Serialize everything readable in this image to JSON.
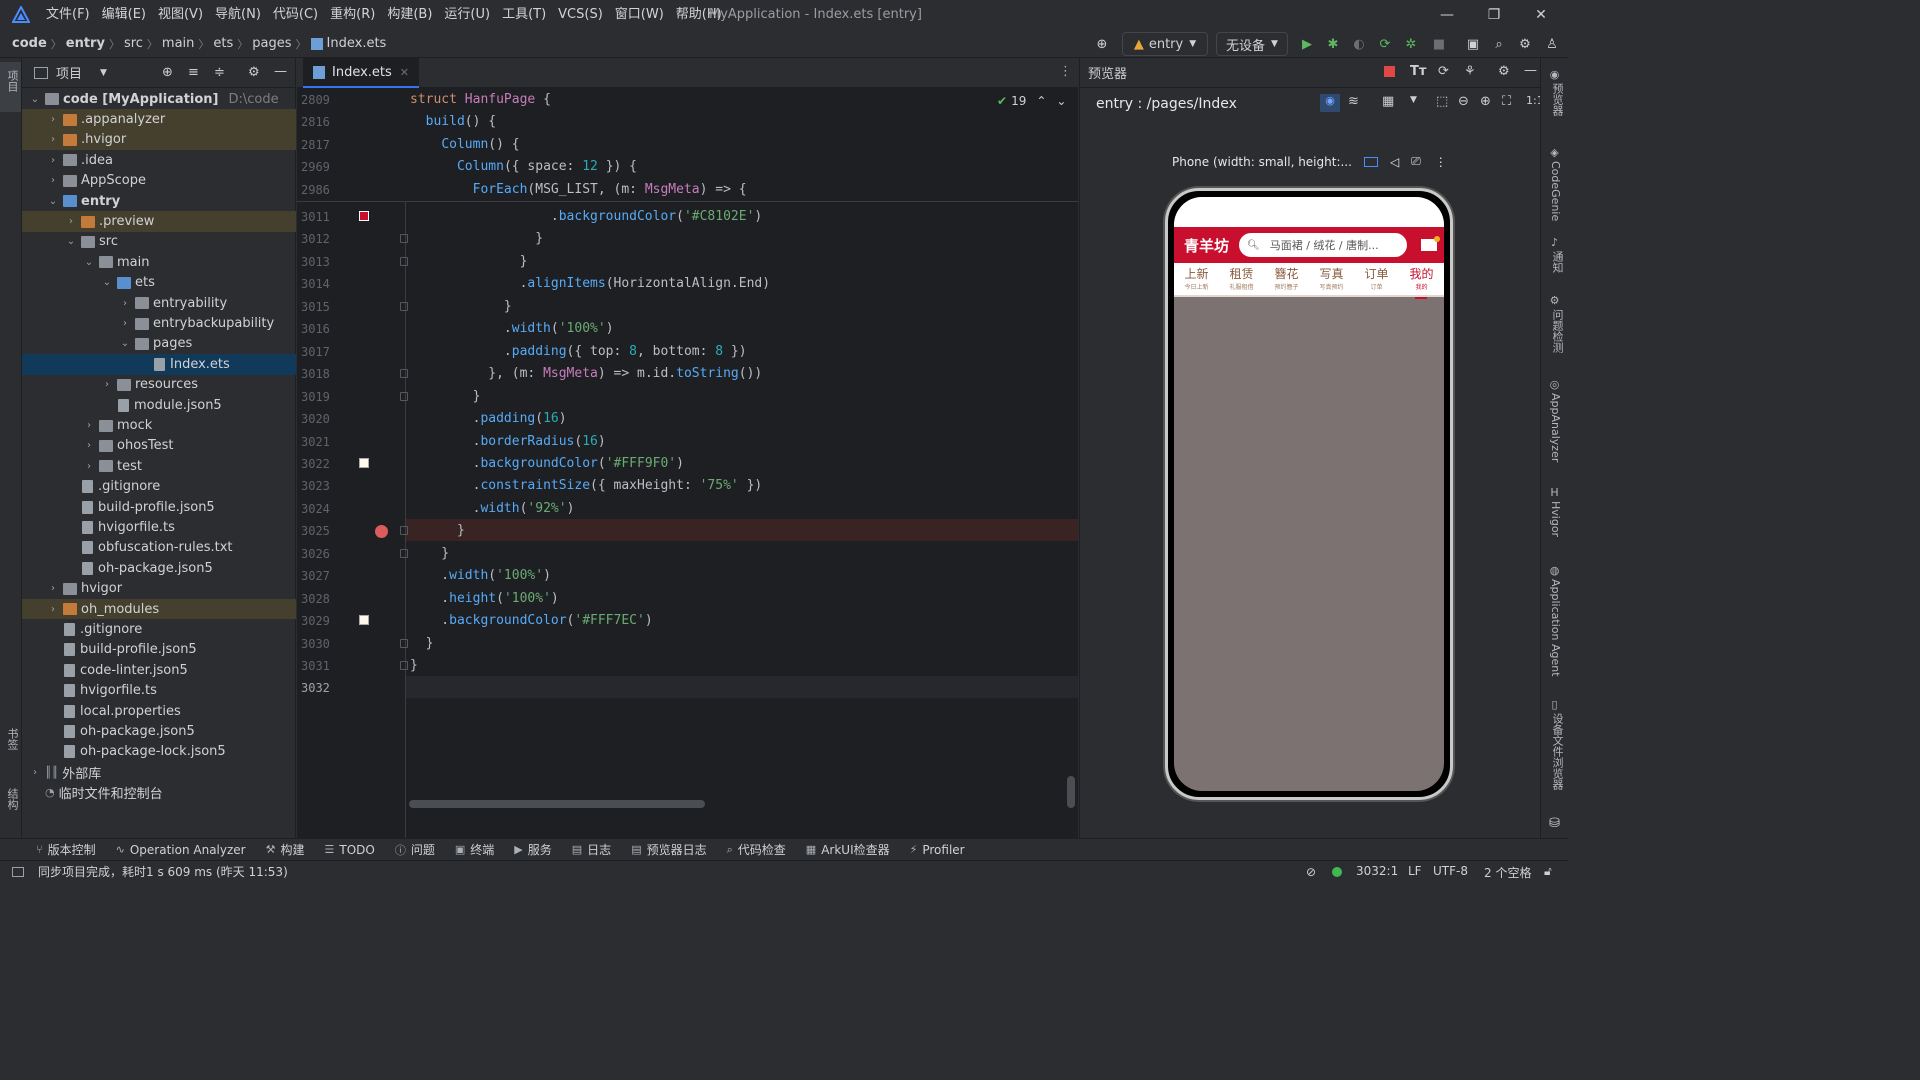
{
  "menu": {
    "items": [
      "文件(F)",
      "编辑(E)",
      "视图(V)",
      "导航(N)",
      "代码(C)",
      "重构(R)",
      "构建(B)",
      "运行(U)",
      "工具(T)",
      "VCS(S)",
      "窗口(W)",
      "帮助(H)"
    ],
    "window_title": "MyApplication - Index.ets [entry]"
  },
  "breadcrumb": {
    "items": [
      "code",
      "entry",
      "src",
      "main",
      "ets",
      "pages",
      "Index.ets"
    ]
  },
  "toolbar": {
    "module": "entry",
    "device": "无设备"
  },
  "project": {
    "title": "项目",
    "tree": [
      {
        "label": "code [MyApplication]",
        "extra": "D:\\code",
        "depth": 0,
        "arrow": "open",
        "icon": "folder",
        "bold": true
      },
      {
        "label": ".appanalyzer",
        "depth": 1,
        "arrow": "closed",
        "icon": "folder-orange",
        "hl": true
      },
      {
        "label": ".hvigor",
        "depth": 1,
        "arrow": "closed",
        "icon": "folder-orange",
        "hl": true
      },
      {
        "label": ".idea",
        "depth": 1,
        "arrow": "closed",
        "icon": "folder"
      },
      {
        "label": "AppScope",
        "depth": 1,
        "arrow": "closed",
        "icon": "folder"
      },
      {
        "label": "entry",
        "depth": 1,
        "arrow": "open",
        "icon": "folder-blue",
        "bold": true
      },
      {
        "label": ".preview",
        "depth": 2,
        "arrow": "closed",
        "icon": "folder-orange",
        "hl": true
      },
      {
        "label": "src",
        "depth": 2,
        "arrow": "open",
        "icon": "folder"
      },
      {
        "label": "main",
        "depth": 3,
        "arrow": "open",
        "icon": "folder"
      },
      {
        "label": "ets",
        "depth": 4,
        "arrow": "open",
        "icon": "folder-blue"
      },
      {
        "label": "entryability",
        "depth": 5,
        "arrow": "closed",
        "icon": "folder"
      },
      {
        "label": "entrybackupability",
        "depth": 5,
        "arrow": "closed",
        "icon": "folder"
      },
      {
        "label": "pages",
        "depth": 5,
        "arrow": "open",
        "icon": "folder"
      },
      {
        "label": "Index.ets",
        "depth": 6,
        "arrow": "none",
        "icon": "file",
        "sel": true
      },
      {
        "label": "resources",
        "depth": 4,
        "arrow": "closed",
        "icon": "folder"
      },
      {
        "label": "module.json5",
        "depth": 4,
        "arrow": "none",
        "icon": "file"
      },
      {
        "label": "mock",
        "depth": 3,
        "arrow": "closed",
        "icon": "folder"
      },
      {
        "label": "ohosTest",
        "depth": 3,
        "arrow": "closed",
        "icon": "folder"
      },
      {
        "label": "test",
        "depth": 3,
        "arrow": "closed",
        "icon": "folder"
      },
      {
        "label": ".gitignore",
        "depth": 2,
        "arrow": "none",
        "icon": "file"
      },
      {
        "label": "build-profile.json5",
        "depth": 2,
        "arrow": "none",
        "icon": "file"
      },
      {
        "label": "hvigorfile.ts",
        "depth": 2,
        "arrow": "none",
        "icon": "file"
      },
      {
        "label": "obfuscation-rules.txt",
        "depth": 2,
        "arrow": "none",
        "icon": "file"
      },
      {
        "label": "oh-package.json5",
        "depth": 2,
        "arrow": "none",
        "icon": "file"
      },
      {
        "label": "hvigor",
        "depth": 1,
        "arrow": "closed",
        "icon": "folder"
      },
      {
        "label": "oh_modules",
        "depth": 1,
        "arrow": "closed",
        "icon": "folder-orange",
        "hl": true
      },
      {
        "label": ".gitignore",
        "depth": 1,
        "arrow": "none",
        "icon": "file"
      },
      {
        "label": "build-profile.json5",
        "depth": 1,
        "arrow": "none",
        "icon": "file"
      },
      {
        "label": "code-linter.json5",
        "depth": 1,
        "arrow": "none",
        "icon": "file"
      },
      {
        "label": "hvigorfile.ts",
        "depth": 1,
        "arrow": "none",
        "icon": "file"
      },
      {
        "label": "local.properties",
        "depth": 1,
        "arrow": "none",
        "icon": "file"
      },
      {
        "label": "oh-package.json5",
        "depth": 1,
        "arrow": "none",
        "icon": "file"
      },
      {
        "label": "oh-package-lock.json5",
        "depth": 1,
        "arrow": "none",
        "icon": "file"
      },
      {
        "label": "外部库",
        "depth": 0,
        "arrow": "closed",
        "icon": "lib"
      },
      {
        "label": "临时文件和控制台",
        "depth": 0,
        "arrow": "none",
        "icon": "scratch"
      }
    ]
  },
  "editor": {
    "tab": "Index.ets",
    "inspections": "19",
    "sticky": [
      {
        "ln": "2809",
        "code": [
          [
            "kw",
            "struct "
          ],
          [
            "ty",
            "HanfuPage"
          ],
          [
            "plain",
            " {"
          ]
        ]
      },
      {
        "ln": "2816",
        "code": [
          [
            "plain",
            "  "
          ],
          [
            "fn",
            "build"
          ],
          [
            "plain",
            "() {"
          ]
        ]
      },
      {
        "ln": "2817",
        "code": [
          [
            "plain",
            "    "
          ],
          [
            "fn",
            "Column"
          ],
          [
            "plain",
            "() {"
          ]
        ]
      },
      {
        "ln": "2969",
        "code": [
          [
            "plain",
            "      "
          ],
          [
            "fn",
            "Column"
          ],
          [
            "plain",
            "({ space: "
          ],
          [
            "num",
            "12"
          ],
          [
            "plain",
            " }) {"
          ]
        ]
      },
      {
        "ln": "2986",
        "code": [
          [
            "plain",
            "        "
          ],
          [
            "fn",
            "ForEach"
          ],
          [
            "plain",
            "(MSG_LIST, (m: "
          ],
          [
            "ty",
            "MsgMeta"
          ],
          [
            "plain",
            ") => {"
          ]
        ]
      }
    ],
    "lines": [
      {
        "ln": "3011",
        "code": [
          [
            "plain",
            "                  ."
          ],
          [
            "fn",
            "backgroundColor"
          ],
          [
            "plain",
            "("
          ],
          [
            "str",
            "'#C8102E'"
          ],
          [
            "plain",
            ")"
          ]
        ]
      },
      {
        "ln": "3012",
        "code": [
          [
            "plain",
            "                }"
          ]
        ]
      },
      {
        "ln": "3013",
        "code": [
          [
            "plain",
            "              }"
          ]
        ]
      },
      {
        "ln": "3014",
        "code": [
          [
            "plain",
            "              ."
          ],
          [
            "fn",
            "alignItems"
          ],
          [
            "plain",
            "(HorizontalAlign.End)"
          ]
        ]
      },
      {
        "ln": "3015",
        "code": [
          [
            "plain",
            "            }"
          ]
        ]
      },
      {
        "ln": "3016",
        "code": [
          [
            "plain",
            "            ."
          ],
          [
            "fn",
            "width"
          ],
          [
            "plain",
            "("
          ],
          [
            "str",
            "'100%'"
          ],
          [
            "plain",
            ")"
          ]
        ]
      },
      {
        "ln": "3017",
        "code": [
          [
            "plain",
            "            ."
          ],
          [
            "fn",
            "padding"
          ],
          [
            "plain",
            "({ top: "
          ],
          [
            "num",
            "8"
          ],
          [
            "plain",
            ", bottom: "
          ],
          [
            "num",
            "8"
          ],
          [
            "plain",
            " })"
          ]
        ]
      },
      {
        "ln": "3018",
        "code": [
          [
            "plain",
            "          }, (m: "
          ],
          [
            "ty",
            "MsgMeta"
          ],
          [
            "plain",
            ") => m.id."
          ],
          [
            "fn",
            "toString"
          ],
          [
            "plain",
            "())"
          ]
        ]
      },
      {
        "ln": "3019",
        "code": [
          [
            "plain",
            "        }"
          ]
        ]
      },
      {
        "ln": "3020",
        "code": [
          [
            "plain",
            "        ."
          ],
          [
            "fn",
            "padding"
          ],
          [
            "plain",
            "("
          ],
          [
            "num",
            "16"
          ],
          [
            "plain",
            ")"
          ]
        ]
      },
      {
        "ln": "3021",
        "code": [
          [
            "plain",
            "        ."
          ],
          [
            "fn",
            "borderRadius"
          ],
          [
            "plain",
            "("
          ],
          [
            "num",
            "16"
          ],
          [
            "plain",
            ")"
          ]
        ]
      },
      {
        "ln": "3022",
        "code": [
          [
            "plain",
            "        ."
          ],
          [
            "fn",
            "backgroundColor"
          ],
          [
            "plain",
            "("
          ],
          [
            "str",
            "'#FFF9F0'"
          ],
          [
            "plain",
            ")"
          ]
        ]
      },
      {
        "ln": "3023",
        "code": [
          [
            "plain",
            "        ."
          ],
          [
            "fn",
            "constraintSize"
          ],
          [
            "plain",
            "({ maxHeight: "
          ],
          [
            "str",
            "'75%'"
          ],
          [
            "plain",
            " })"
          ]
        ]
      },
      {
        "ln": "3024",
        "code": [
          [
            "plain",
            "        ."
          ],
          [
            "fn",
            "width"
          ],
          [
            "plain",
            "("
          ],
          [
            "str",
            "'92%'"
          ],
          [
            "plain",
            ")"
          ]
        ]
      },
      {
        "ln": "3025",
        "code": [
          [
            "plain",
            "      }"
          ]
        ]
      },
      {
        "ln": "3026",
        "code": [
          [
            "plain",
            "    }"
          ]
        ]
      },
      {
        "ln": "3027",
        "code": [
          [
            "plain",
            "    ."
          ],
          [
            "fn",
            "width"
          ],
          [
            "plain",
            "("
          ],
          [
            "str",
            "'100%'"
          ],
          [
            "plain",
            ")"
          ]
        ]
      },
      {
        "ln": "3028",
        "code": [
          [
            "plain",
            "    ."
          ],
          [
            "fn",
            "height"
          ],
          [
            "plain",
            "("
          ],
          [
            "str",
            "'100%'"
          ],
          [
            "plain",
            ")"
          ]
        ]
      },
      {
        "ln": "3029",
        "code": [
          [
            "plain",
            "    ."
          ],
          [
            "fn",
            "backgroundColor"
          ],
          [
            "plain",
            "("
          ],
          [
            "str",
            "'#FFF7EC'"
          ],
          [
            "plain",
            ")"
          ]
        ]
      },
      {
        "ln": "3030",
        "code": [
          [
            "plain",
            "  }"
          ]
        ]
      },
      {
        "ln": "3031",
        "code": [
          [
            "plain",
            "}"
          ]
        ]
      },
      {
        "ln": "3032",
        "code": []
      }
    ]
  },
  "preview": {
    "title": "预览器",
    "route": "entry : /pages/Index",
    "device": "Phone (width: small, height:...",
    "app": {
      "brand": "青羊坊",
      "search": "马面裙 / 绒花 / 唐制...",
      "tabs": [
        {
          "label": "上新",
          "sub": "今日上新",
          "active": false
        },
        {
          "label": "租赁",
          "sub": "礼服租借",
          "active": false
        },
        {
          "label": "簪花",
          "sub": "预约簪子",
          "active": false
        },
        {
          "label": "写真",
          "sub": "写真预约",
          "active": false
        },
        {
          "label": "订单",
          "sub": "订单",
          "active": false
        },
        {
          "label": "我的",
          "sub": "我的",
          "active": true
        }
      ],
      "brand_color": "#C8102E"
    }
  },
  "right_stripe": [
    "预览器",
    "CodeGenie",
    "通知",
    "问题检测",
    "AppAnalyzer",
    "Hvigor",
    "Application Agent",
    "设备文件浏览器"
  ],
  "left_stripe": [
    "项目",
    "书签",
    "结构"
  ],
  "bottom_tools": [
    "版本控制",
    "Operation Analyzer",
    "构建",
    "TODO",
    "问题",
    "终端",
    "服务",
    "日志",
    "预览器日志",
    "代码检查",
    "ArkUI检查器",
    "Profiler"
  ],
  "status": {
    "message": "同步项目完成，耗时1 s 609 ms (昨天 11:53)",
    "position": "3032:1",
    "line_sep": "LF",
    "encoding": "UTF-8",
    "indent": "2 个空格"
  }
}
